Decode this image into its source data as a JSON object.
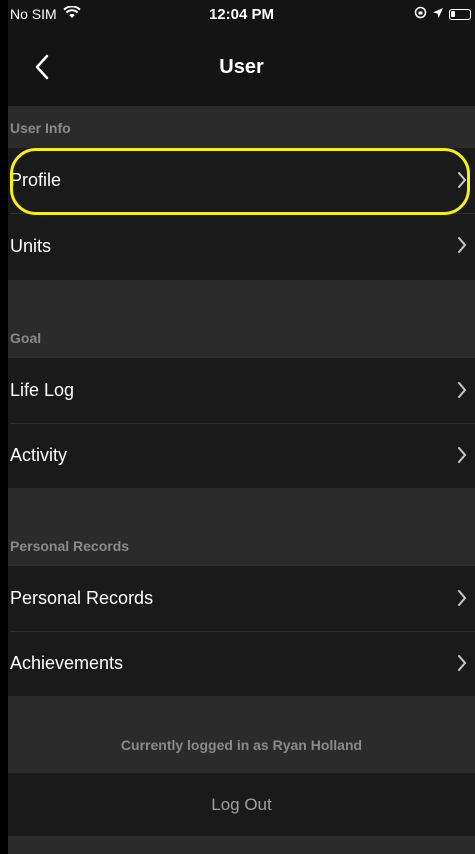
{
  "status_bar": {
    "carrier": "No SIM",
    "time": "12:04 PM"
  },
  "nav": {
    "title": "User"
  },
  "sections": {
    "user_info": {
      "header": "User Info",
      "items": [
        "Profile",
        "Units"
      ]
    },
    "goal": {
      "header": "Goal",
      "items": [
        "Life Log",
        "Activity"
      ]
    },
    "personal_records": {
      "header": "Personal Records",
      "items": [
        "Personal Records",
        "Achievements"
      ]
    }
  },
  "account": {
    "logged_in_text": "Currently logged in as Ryan Holland",
    "logout_label": "Log Out"
  },
  "colors": {
    "background": "#2b2b2b",
    "cell": "#1a1a1a",
    "highlight": "#f5ee17"
  },
  "icons": [
    "wifi-icon",
    "orientation-lock-icon",
    "location-arrow-icon",
    "battery-icon",
    "back-chevron-icon",
    "chevron-right-icon"
  ]
}
